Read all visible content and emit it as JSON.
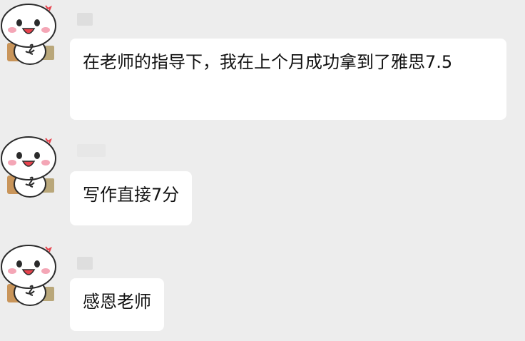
{
  "chat": {
    "messages": [
      {
        "text": "在老师的指导下，我在上个月成功拿到了雅思7.5"
      },
      {
        "text": "写作直接7分"
      },
      {
        "text": "感恩老师"
      }
    ]
  },
  "avatar": {
    "icon": "cartoon-face-avatar-icon",
    "colors": {
      "face": "#ffffff",
      "outline": "#2b2b2b",
      "mouth": "#e8434d",
      "blush": "#f4a6b6",
      "box": "#c9955a"
    }
  },
  "colors": {
    "background": "#ededed",
    "bubble": "#ffffff",
    "text": "#111111",
    "name_placeholder": "#dcdcdc"
  }
}
